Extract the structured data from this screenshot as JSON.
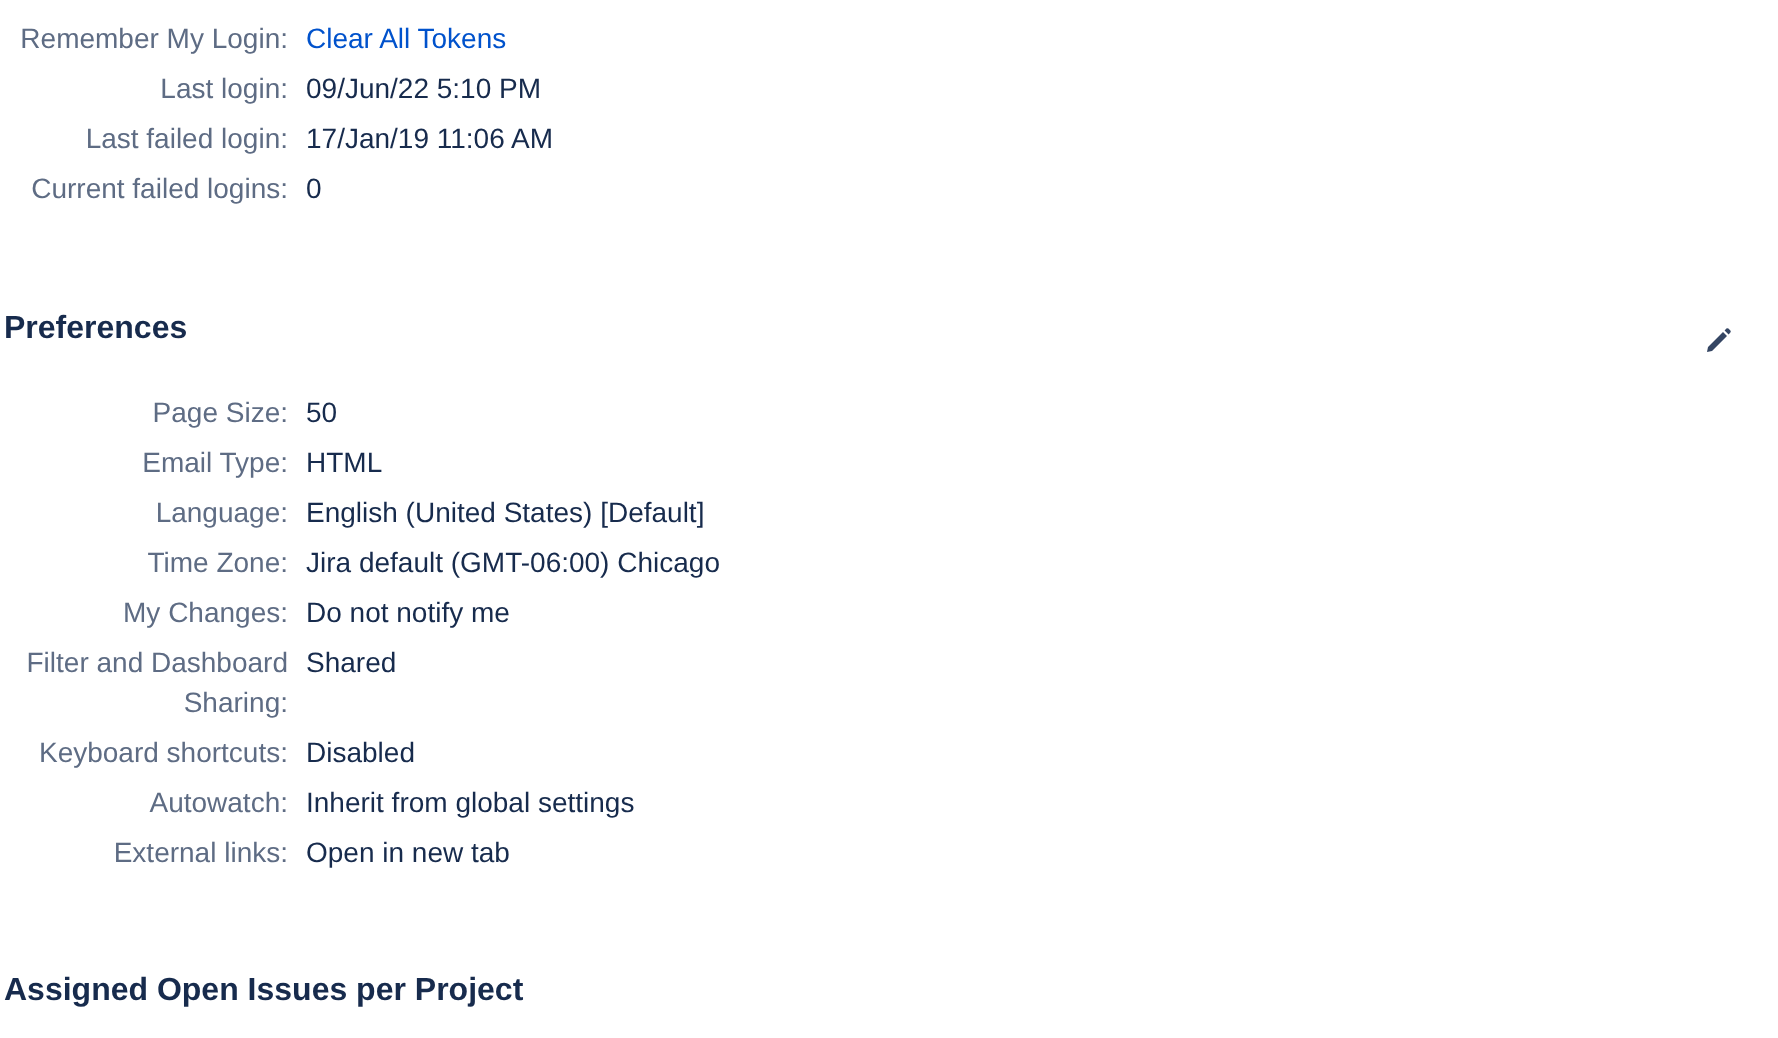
{
  "login_details": [
    {
      "label": "Remember My Login:",
      "value": "Clear All Tokens",
      "kind": "link"
    },
    {
      "label": "Last login:",
      "value": "09/Jun/22 5:10 PM",
      "kind": "text"
    },
    {
      "label": "Last failed login:",
      "value": "17/Jan/19 11:06 AM",
      "kind": "text"
    },
    {
      "label": "Current failed logins:",
      "value": "0",
      "kind": "text"
    }
  ],
  "preferences": {
    "title": "Preferences",
    "rows": [
      {
        "label": "Page Size:",
        "value": "50"
      },
      {
        "label": "Email Type:",
        "value": "HTML"
      },
      {
        "label": "Language:",
        "value": "English (United States) [Default]"
      },
      {
        "label": "Time Zone:",
        "value": "Jira default (GMT-06:00) Chicago"
      },
      {
        "label": "My Changes:",
        "value": "Do not notify me"
      },
      {
        "label": "Filter and Dashboard Sharing:",
        "value": "Shared"
      },
      {
        "label": "Keyboard shortcuts:",
        "value": "Disabled"
      },
      {
        "label": "Autowatch:",
        "value": "Inherit from global settings"
      },
      {
        "label": "External links:",
        "value": "Open in new tab"
      }
    ]
  },
  "assigned_issues": {
    "title": "Assigned Open Issues per Project"
  }
}
